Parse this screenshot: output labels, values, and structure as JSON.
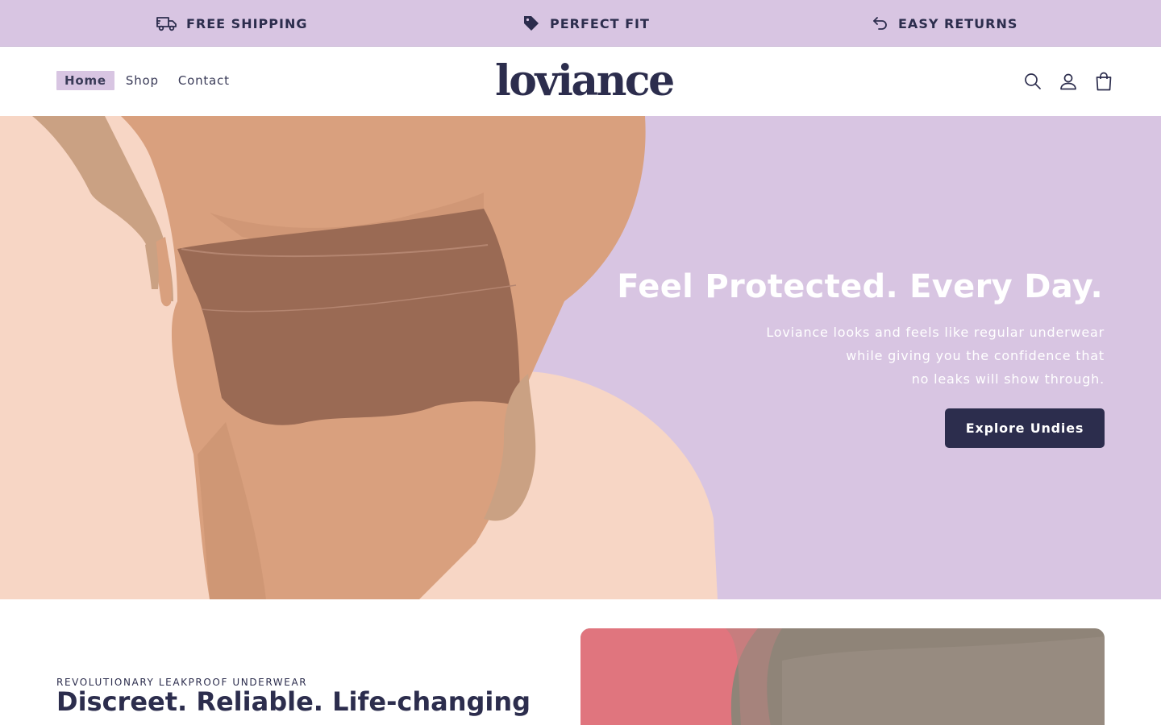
{
  "announcement": {
    "items": [
      {
        "icon": "truck-icon",
        "label": "FREE SHIPPING"
      },
      {
        "icon": "tag-icon",
        "label": "PERFECT FIT"
      },
      {
        "icon": "return-arrow-icon",
        "label": "EASY RETURNS"
      }
    ]
  },
  "header": {
    "nav": [
      {
        "label": "Home",
        "active": true
      },
      {
        "label": "Shop",
        "active": false
      },
      {
        "label": "Contact",
        "active": false
      }
    ],
    "logo": "loviance",
    "icons": [
      "search-icon",
      "account-icon",
      "cart-icon"
    ]
  },
  "hero": {
    "title": "Feel Protected. Every Day.",
    "subtitle_lines": [
      "Loviance looks and feels like regular underwear",
      "while giving you the confidence that",
      "no leaks will show through."
    ],
    "button": "Explore Undies"
  },
  "feature": {
    "eyebrow": "REVOLUTIONARY LEAKPROOF UNDERWEAR",
    "title": "Discreet. Reliable. Life-changing"
  },
  "colors": {
    "brand_navy": "#2c2d4d",
    "lavender": "#d8c5e2",
    "peach": "#f7d6c5",
    "skin": "#d9a07e",
    "garment": "#9a6a54"
  }
}
